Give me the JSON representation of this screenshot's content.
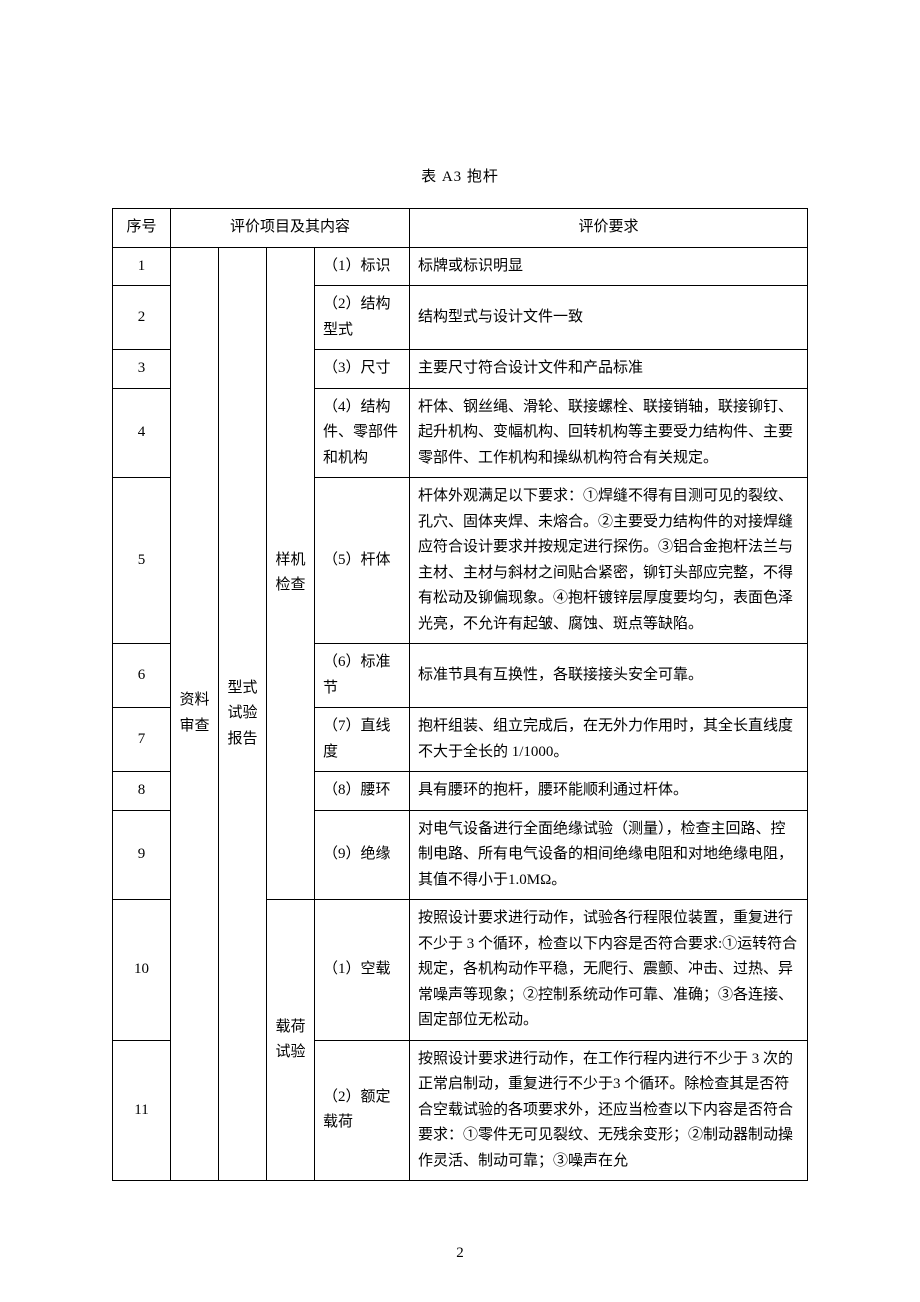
{
  "title": "表 A3 抱杆",
  "headers": {
    "seq": "序号",
    "content": "评价项目及其内容",
    "req": "评价要求"
  },
  "group_a": "资料审查",
  "group_b": "型式试验报告",
  "group_c1": "样机检查",
  "group_c2": "载荷试验",
  "rows": {
    "r1": {
      "seq": "1",
      "d": "（1）标识",
      "e": "标牌或标识明显"
    },
    "r2": {
      "seq": "2",
      "d": "（2）结构型式",
      "e": "结构型式与设计文件一致"
    },
    "r3": {
      "seq": "3",
      "d": "（3）尺寸",
      "e": "主要尺寸符合设计文件和产品标准"
    },
    "r4": {
      "seq": "4",
      "d": "（4）结构件、零部件和机构",
      "e": "杆体、钢丝绳、滑轮、联接螺栓、联接销轴，联接铆钉、起升机构、变幅机构、回转机构等主要受力结构件、主要零部件、工作机构和操纵机构符合有关规定。"
    },
    "r5": {
      "seq": "5",
      "d": "（5）杆体",
      "e": "杆体外观满足以下要求：①焊缝不得有目测可见的裂纹、孔穴、固体夹焊、未熔合。②主要受力结构件的对接焊缝应符合设计要求并按规定进行探伤。③铝合金抱杆法兰与主材、主材与斜材之间贴合紧密，铆钉头部应完整，不得有松动及铆偏现象。④抱杆镀锌层厚度要均匀，表面色泽光亮，不允许有起皱、腐蚀、斑点等缺陷。"
    },
    "r6": {
      "seq": "6",
      "d": "（6）标准节",
      "e": "标准节具有互换性，各联接接头安全可靠。"
    },
    "r7": {
      "seq": "7",
      "d": "（7）直线度",
      "e": "抱杆组装、组立完成后，在无外力作用时，其全长直线度不大于全长的 1/1000。"
    },
    "r8": {
      "seq": "8",
      "d": "（8）腰环",
      "e": "具有腰环的抱杆，腰环能顺利通过杆体。"
    },
    "r9": {
      "seq": "9",
      "d": "（9）绝缘",
      "e": "对电气设备进行全面绝缘试验（测量），检查主回路、控制电路、所有电气设备的相间绝缘电阻和对地绝缘电阻，其值不得小于1.0MΩ。"
    },
    "r10": {
      "seq": "10",
      "d": "（1）空载",
      "e": "按照设计要求进行动作，试验各行程限位装置，重复进行不少于 3 个循环，检查以下内容是否符合要求:①运转符合规定，各机构动作平稳，无爬行、震颤、冲击、过热、异常噪声等现象；②控制系统动作可靠、准确；③各连接、固定部位无松动。"
    },
    "r11": {
      "seq": "11",
      "d": "（2）额定载荷",
      "e": "按照设计要求进行动作，在工作行程内进行不少于 3 次的正常启制动，重复进行不少于3 个循环。除检查其是否符合空载试验的各项要求外，还应当检查以下内容是否符合要求：①零件无可见裂纹、无残余变形；②制动器制动操作灵活、制动可靠；③噪声在允"
    }
  },
  "page_number": "2"
}
